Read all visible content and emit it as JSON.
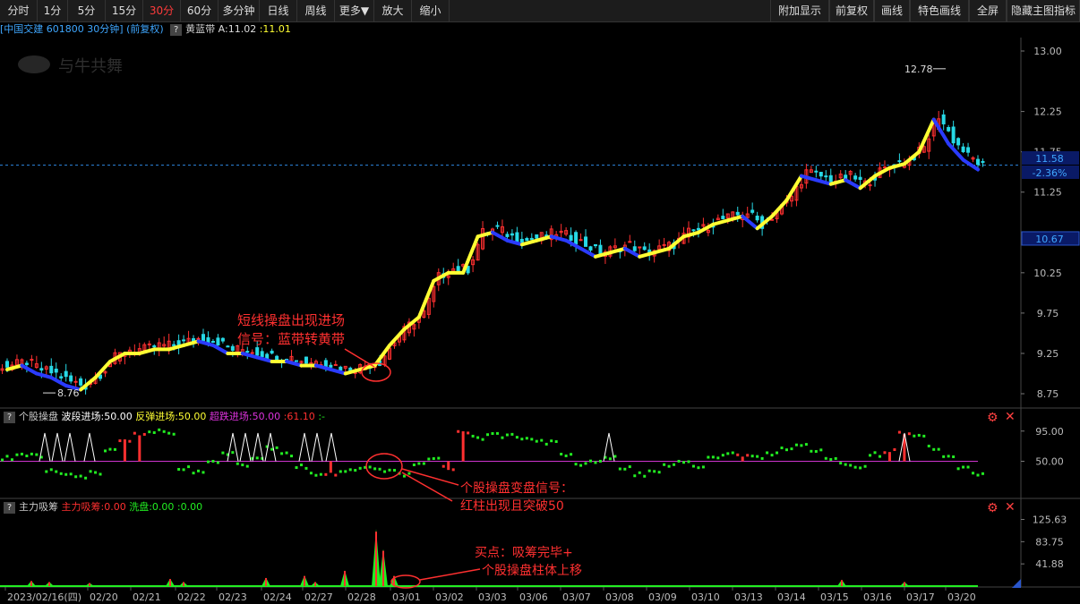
{
  "toolbar": {
    "left": [
      "分时",
      "1分",
      "5分",
      "15分",
      "30分",
      "60分",
      "多分钟",
      "日线",
      "周线",
      "更多▼",
      "放大",
      "缩小"
    ],
    "active": "30分",
    "right": [
      "附加显示",
      "前复权",
      "画线",
      "特色画线",
      "全屏",
      "隐藏主图指标"
    ]
  },
  "main": {
    "stock_label": "[中国交建 601800 30分钟]",
    "adjust_label": "(前复权)",
    "indicator_name": "黄蓝带",
    "indicator_a": "A:11.02",
    "indicator_b": ":11.01",
    "watermark": "与牛共舞",
    "axis_ticks": [
      "13.00",
      "12.25",
      "11.75",
      "11.25",
      "10.25",
      "9.75",
      "9.25",
      "8.75"
    ],
    "current_price": "11.58",
    "change_pct": "-2.36%",
    "price_10_67": "10.67",
    "high_label": "12.78",
    "low_label": "8.76",
    "annotation": [
      "短线操盘出现进场",
      "信号：蓝带转黄带"
    ]
  },
  "sub1": {
    "name": "个股操盘",
    "label1": "波段进场:50.00",
    "label2": "反弹进场:50.00",
    "label3": "超跌进场:50.00",
    "label4": ":61.10",
    "label5": ":-",
    "axis_ticks": [
      "95.00",
      "50.00"
    ],
    "annotation": [
      "个股操盘变盘信号：",
      "红柱出现且突破50"
    ]
  },
  "sub2": {
    "name": "主力吸筹",
    "label1": "主力吸筹:0.00",
    "label2": "洗盘:0.00",
    "label3": ":0.00",
    "axis_ticks": [
      "125.63",
      "83.75",
      "41.88"
    ],
    "annotation": [
      "买点：吸筹完毕+",
      "个股操盘柱体上移"
    ]
  },
  "dates": [
    "2023/02/16(四)",
    "02/20",
    "02/21",
    "02/22",
    "02/23",
    "02/24",
    "02/27",
    "02/28",
    "03/01",
    "03/02",
    "03/03",
    "03/06",
    "03/07",
    "03/08",
    "03/09",
    "03/10",
    "03/13",
    "03/14",
    "03/15",
    "03/16",
    "03/17",
    "03/20"
  ],
  "colors": {
    "up": "#ff3030",
    "down": "#27d9e6",
    "yellow": "#ffff33",
    "blue": "#2a3bff",
    "green": "#22ee22",
    "magenta": "#cc33cc"
  },
  "chart_data": {
    "type": "candlestick",
    "price_range": [
      8.6,
      13.05
    ],
    "close_approx": [
      9.1,
      9.15,
      9.05,
      9.0,
      8.9,
      8.85,
      9.0,
      9.2,
      9.3,
      9.3,
      9.35,
      9.35,
      9.4,
      9.45,
      9.4,
      9.3,
      9.3,
      9.25,
      9.2,
      9.2,
      9.15,
      9.15,
      9.1,
      9.05,
      9.1,
      9.15,
      9.4,
      9.6,
      9.75,
      10.2,
      10.3,
      10.3,
      10.75,
      10.8,
      10.7,
      10.65,
      10.7,
      10.75,
      10.7,
      10.6,
      10.5,
      10.55,
      10.6,
      10.5,
      10.55,
      10.6,
      10.75,
      10.8,
      10.9,
      10.95,
      11.0,
      10.85,
      11.0,
      11.2,
      11.5,
      11.45,
      11.4,
      11.45,
      11.35,
      11.5,
      11.6,
      11.65,
      11.8,
      12.2,
      11.9,
      11.7,
      11.58
    ]
  }
}
